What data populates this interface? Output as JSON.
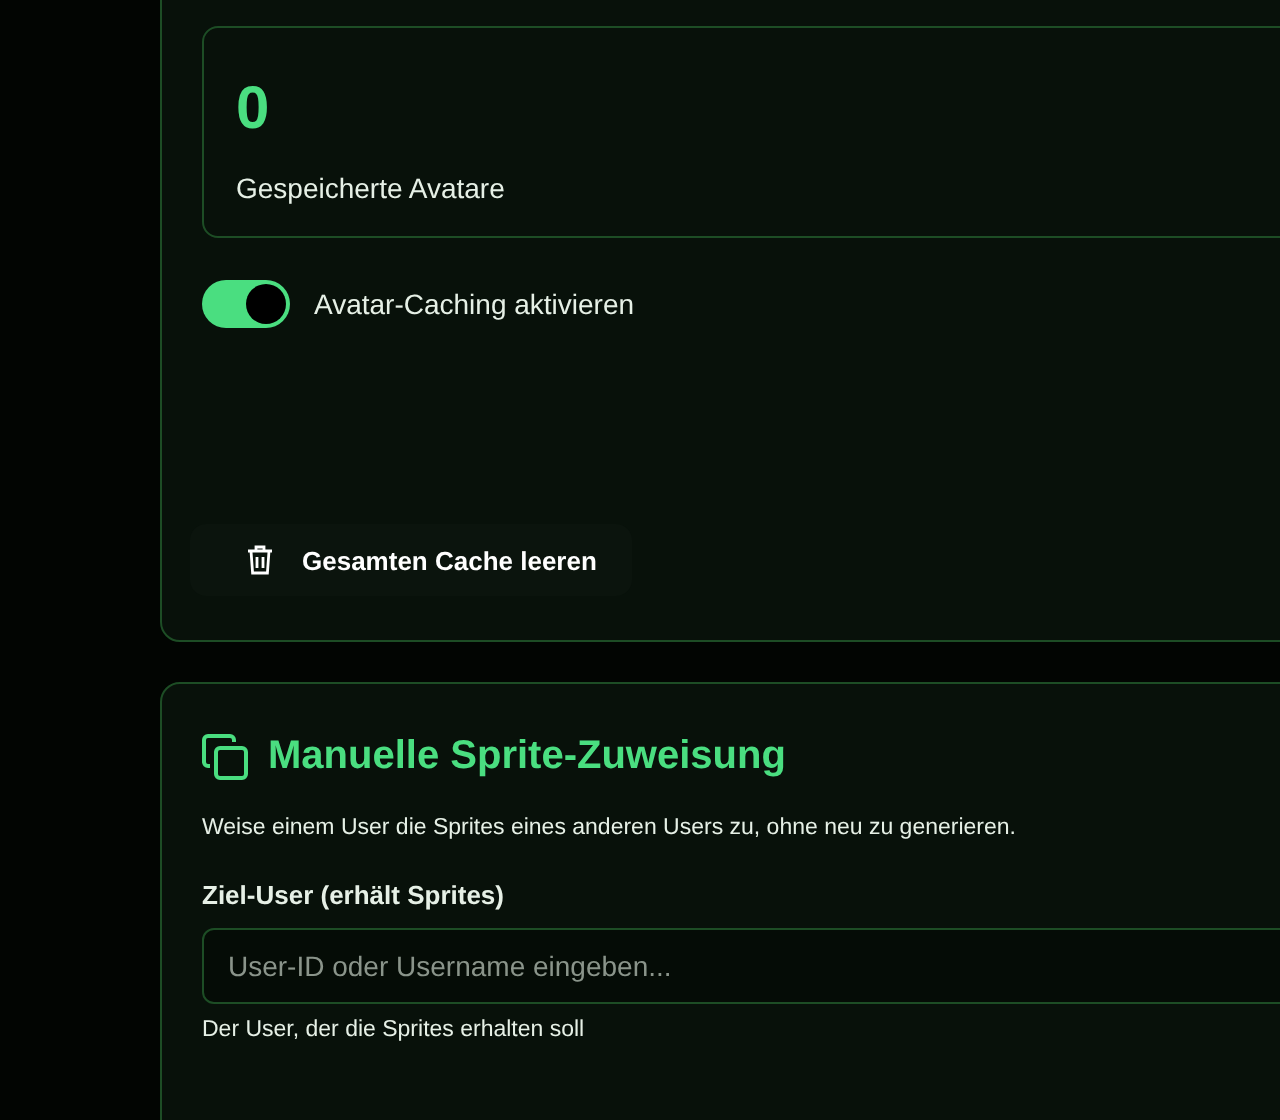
{
  "cache_card": {
    "stat": {
      "value": "0",
      "label": "Gespeicherte Avatare"
    },
    "toggle": {
      "label": "Avatar-Caching aktivieren",
      "on": true
    },
    "clear_button": {
      "label": "Gesamten Cache leeren"
    }
  },
  "sprite_card": {
    "title": "Manuelle Sprite-Zuweisung",
    "description": "Weise einem User die Sprites eines anderen Users zu, ohne neu zu generieren.",
    "target_field": {
      "label": "Ziel-User (erhält Sprites)",
      "placeholder": "User-ID oder Username eingeben...",
      "hint": "Der User, der die Sprites erhalten soll"
    }
  }
}
